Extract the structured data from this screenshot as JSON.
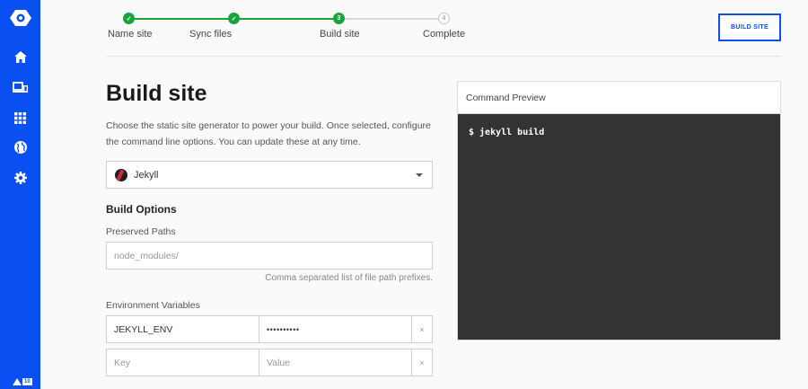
{
  "sidebar": {
    "icons": [
      "logo-icon",
      "home-icon",
      "devices-icon",
      "apps-grid-icon",
      "globe-icon",
      "gear-icon"
    ],
    "badge": "10"
  },
  "stepper": {
    "steps": [
      {
        "label": "Name site",
        "marker": "✓",
        "state": "done"
      },
      {
        "label": "Sync files",
        "marker": "✓",
        "state": "done"
      },
      {
        "label": "Build site",
        "marker": "3",
        "state": "current"
      },
      {
        "label": "Complete",
        "marker": "4",
        "state": "todo"
      }
    ],
    "accent": "#1aa33b"
  },
  "header": {
    "button_label": "BUILD SITE"
  },
  "main": {
    "title": "Build site",
    "description": "Choose the static site generator to power your build. Once selected, configure the command line options. You can update these at any time.",
    "generator": {
      "selected": "Jekyll",
      "icon": "jekyll-logo-icon"
    },
    "build_options_title": "Build Options",
    "preserved_paths": {
      "label": "Preserved Paths",
      "value": "",
      "placeholder": "node_modules/",
      "help": "Comma separated list of file path prefixes."
    },
    "env_vars": {
      "label": "Environment Variables",
      "rows": [
        {
          "key": "JEKYLL_ENV",
          "value": "••••••••••",
          "remove": "×"
        },
        {
          "key": "",
          "key_placeholder": "Key",
          "value": "",
          "value_placeholder": "Value",
          "remove": "×"
        }
      ]
    }
  },
  "preview": {
    "title": "Command Preview",
    "command": "$ jekyll build"
  },
  "colors": {
    "brand": "#0a4ff2",
    "terminal_bg": "#333333"
  }
}
